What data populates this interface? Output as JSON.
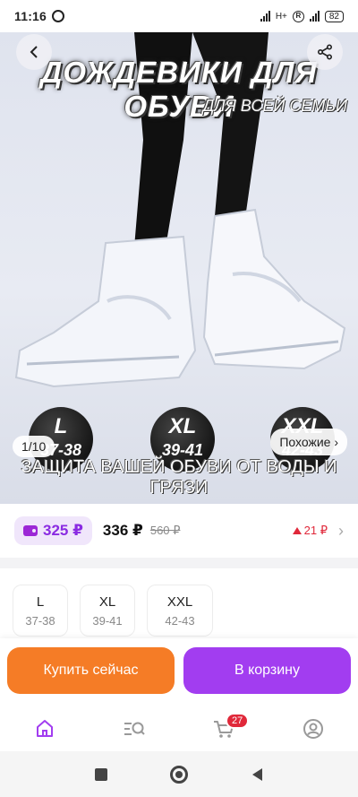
{
  "status_bar": {
    "time": "11:16",
    "network": "H+",
    "battery": "82"
  },
  "hero": {
    "title": "ДОЖДЕВИКИ ДЛЯ ОБУВИ",
    "subtitle": "ДЛЯ ВСЕЙ СЕМЬИ",
    "caption": "ЗАЩИТА ВАШЕЙ ОБУВИ ОТ ВОДЫ И ГРЯЗИ",
    "size_badges": [
      {
        "size": "L",
        "range": "37-38"
      },
      {
        "size": "XL",
        "range": "39-41"
      },
      {
        "size": "XXL",
        "range": "42-43"
      }
    ],
    "image_counter": "1/10",
    "similar_label": "Похожие ›"
  },
  "price": {
    "wallet_price": "325 ₽",
    "current": "336 ₽",
    "old": "560 ₽",
    "difference": "21 ₽"
  },
  "sizes": [
    {
      "name": "L",
      "range": "37-38"
    },
    {
      "name": "XL",
      "range": "39-41"
    },
    {
      "name": "XXL",
      "range": "42-43"
    }
  ],
  "actions": {
    "buy_now": "Купить сейчас",
    "add_to_cart": "В корзину"
  },
  "bottom_nav": {
    "cart_badge": "27",
    "items": [
      "home-icon",
      "catalog-search-icon",
      "cart-icon",
      "profile-icon"
    ]
  },
  "colors": {
    "buy_button": "#f57c26",
    "cart_button": "#a23df0",
    "wallet_accent": "#8a2be2",
    "price_up": "#e0283a"
  }
}
